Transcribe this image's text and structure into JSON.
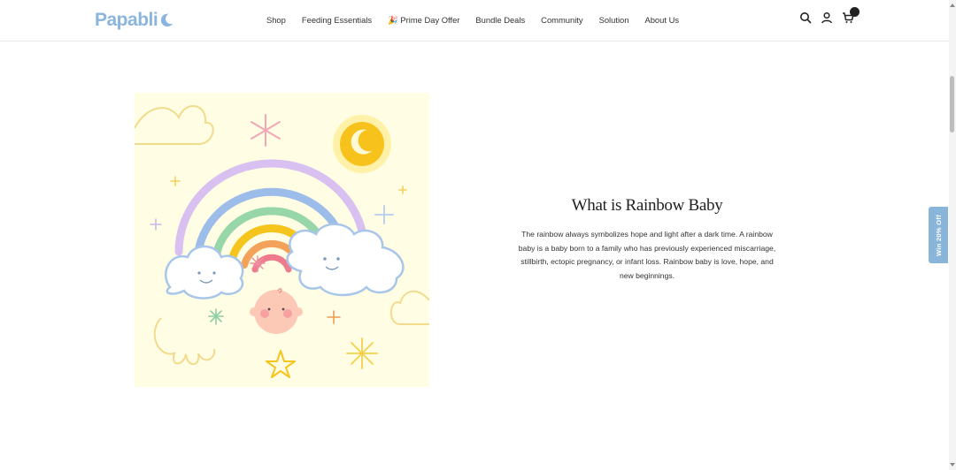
{
  "header": {
    "logo_text": "Papabli",
    "nav": [
      "Shop",
      "Feeding Essentials",
      "🎉 Prime Day Offer",
      "Bundle Deals",
      "Community",
      "Solution",
      "About Us"
    ],
    "icons": [
      "search-icon",
      "account-icon",
      "cart-icon"
    ]
  },
  "content": {
    "heading": "What is Rainbow Baby",
    "body": "The rainbow always symbolizes hope and light after a dark time. A rainbow baby is a baby born to a family who has previously experienced miscarriage, stillbirth, ectopic pregnancy, or infant loss. Rainbow baby is love, hope, and new beginnings."
  },
  "side_tab": {
    "label": "Win 20% Off"
  },
  "colors": {
    "brand": "#8bb5dc",
    "illustration_bg": "#fffde3",
    "side_tab": "#8ab5db"
  }
}
